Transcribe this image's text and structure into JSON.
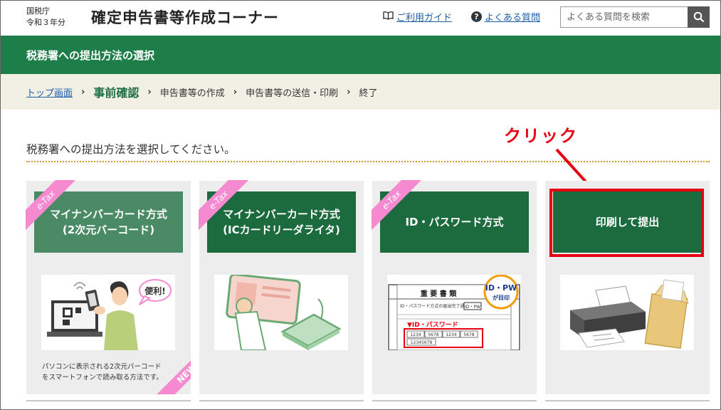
{
  "header": {
    "agency": "国税庁",
    "year": "令和３年分",
    "title": "確定申告書等作成コーナー",
    "guide_label": "ご利用ガイド",
    "faq_label": "よくある質問",
    "search_placeholder": "よくある質問を検索"
  },
  "titlebar": {
    "title": "税務署への提出方法の選択"
  },
  "breadcrumb": {
    "items": [
      "トップ画面",
      "事前確認",
      "申告書等の作成",
      "申告書等の送信・印刷",
      "終了"
    ],
    "separator": "›"
  },
  "instruction": "税務署への提出方法を選択してください。",
  "annotation": {
    "label": "クリック",
    "color": "#e60012"
  },
  "cards": [
    {
      "ribbon": "e-Tax",
      "button_line1": "マイナンバーカード方式",
      "button_line2": "(2次元バーコード)",
      "note_line1": "パソコンに表示される2次元バーコード",
      "note_line2": "をスマートフォンで読み取る方法です。",
      "badge": "NEW",
      "bubble": "便利!"
    },
    {
      "ribbon": "e-Tax",
      "button_line1": "マイナンバーカード方式",
      "button_line2": "(ICカードリーダライタ)"
    },
    {
      "ribbon": "e-Tax",
      "button_line1": "ID・パスワード方式",
      "doc_heading": "重 要 書 類",
      "doc_sub": "ID・パスワード方式の届出完了通知",
      "doc_tag": "ID・PW",
      "stamp_line1": "ID・PW",
      "stamp_line2": "が目印",
      "pw_label": "▼ID・パスワード",
      "pw_cells": [
        "1234",
        "5678",
        "1234",
        "5678"
      ],
      "pw_id": "12345678"
    },
    {
      "button_line1": "印刷して提出"
    }
  ],
  "colors": {
    "brand_green": "#1e7e4a",
    "button_dark": "#1b6b3e",
    "button_light": "#4a8b66",
    "ribbon_pink": "#f58ad0",
    "link_blue": "#1a5fa8"
  }
}
